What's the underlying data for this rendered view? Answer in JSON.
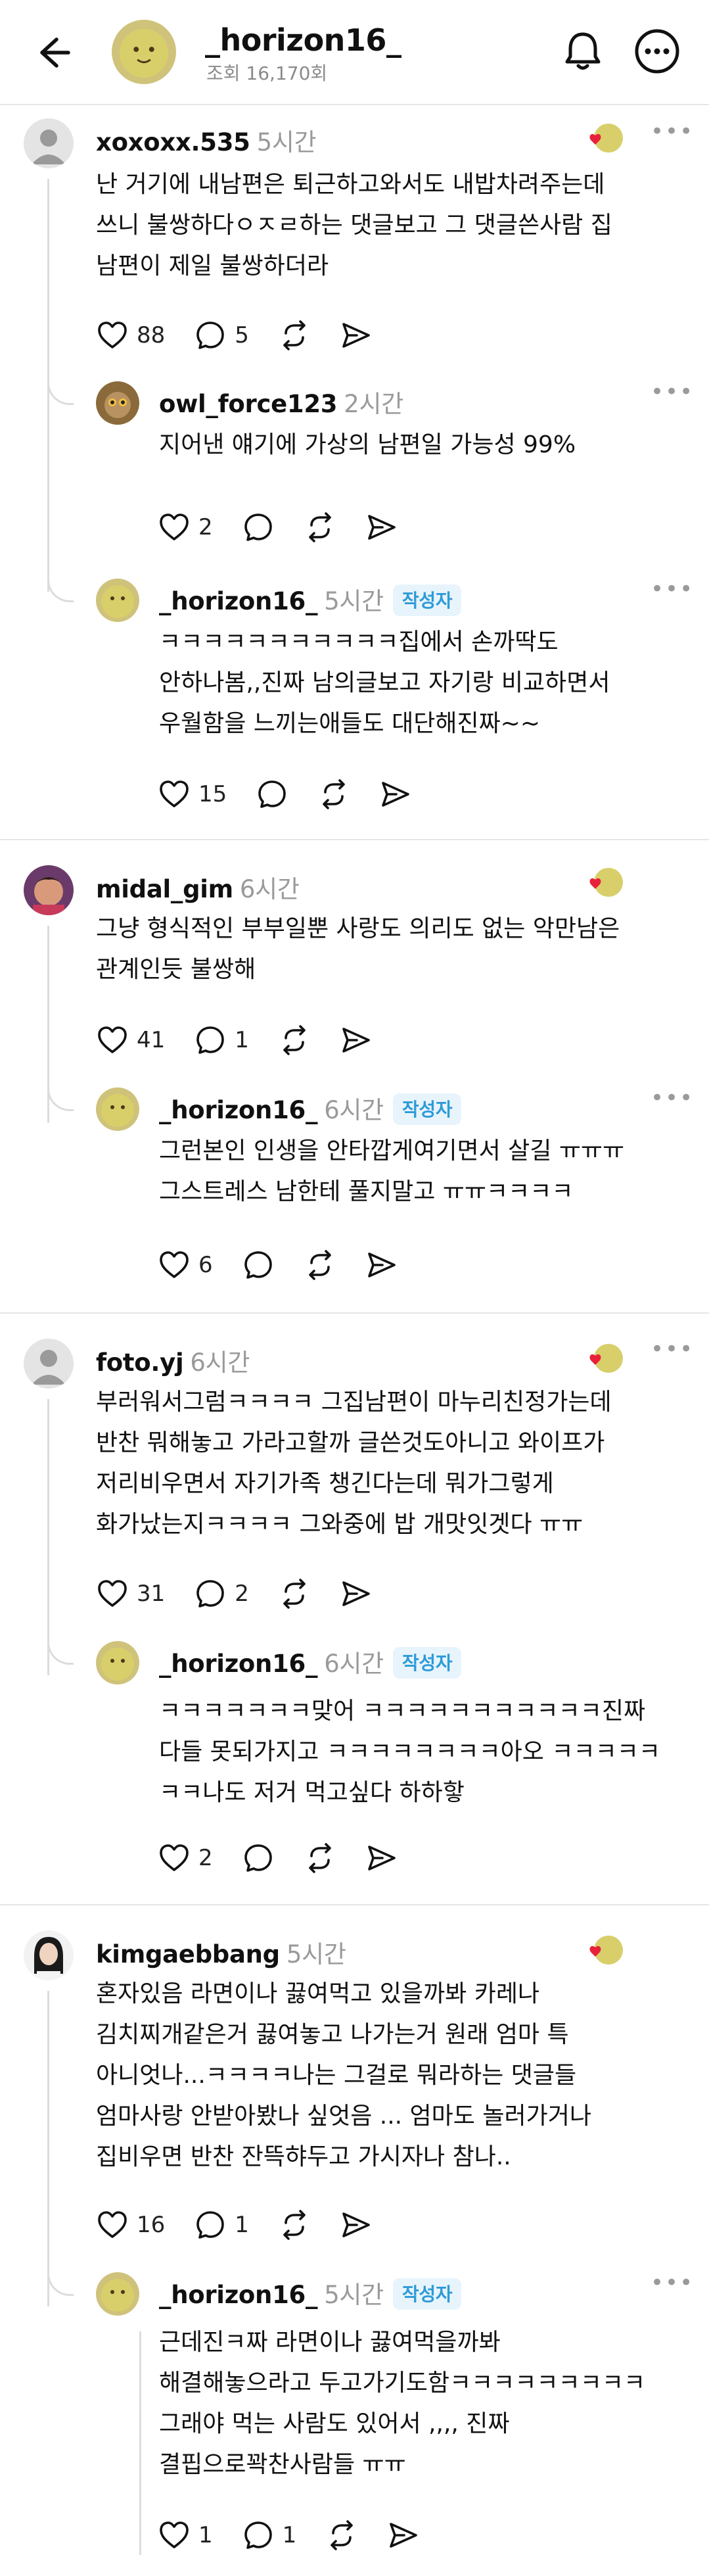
{
  "header": {
    "username": "_horizon16_",
    "views": "조회 16,170회"
  },
  "comments": [
    {
      "user": "xoxoxx.535",
      "time": "5시간",
      "lines": [
        "난 거기에 내남편은 퇴근하고와서도 내밥차려주는데",
        "쓰니 불쌍하다ㅇㅈㄹ하는 댓글보고 그 댓글쓴사람 집",
        "남편이 제일 불쌍하더라"
      ],
      "likes": "88",
      "replies": "5"
    },
    {
      "user": "owl_force123",
      "time": "2시간",
      "lines": [
        "지어낸 얘기에 가상의 남편일 가능성 99%"
      ],
      "likes": "2",
      "replies": ""
    },
    {
      "user": "_horizon16_",
      "time": "5시간",
      "badge": "작성자",
      "lines": [
        "ㅋㅋㅋㅋㅋㅋㅋㅋㅋㅋㅋ집에서 손까딱도",
        "안하나봄,,진짜 남의글보고 자기랑 비교하면서",
        "우월함을 느끼는애들도 대단해진짜~~"
      ],
      "likes": "15",
      "replies": ""
    },
    {
      "user": "midal_gim",
      "time": "6시간",
      "lines": [
        "그냥 형식적인 부부일뿐 사랑도 의리도 없는 악만남은",
        "관계인듯 불쌍해"
      ],
      "likes": "41",
      "replies": "1"
    },
    {
      "user": "_horizon16_",
      "time": "6시간",
      "badge": "작성자",
      "lines": [
        "그런본인 인생을 안타깝게여기면서 살길 ㅠㅠㅠ",
        "그스트레스 남한테 풀지말고 ㅠㅠㅋㅋㅋㅋ"
      ],
      "likes": "6",
      "replies": ""
    },
    {
      "user": "foto.yj",
      "time": "6시간",
      "lines": [
        "부러워서그럼ㅋㅋㅋㅋ 그집남편이 마누리친정가는데",
        "반찬 뭐해놓고 가라고할까 글쓴것도아니고 와이프가",
        "저리비우면서 자기가족 챙긴다는데 뭐가그렇게",
        "화가났는지ㅋㅋㅋㅋ 그와중에 밥 개맛잇겟다 ㅠㅠ"
      ],
      "likes": "31",
      "replies": "2"
    },
    {
      "user": "_horizon16_",
      "time": "6시간",
      "badge": "작성자",
      "lines": [
        "ㅋㅋㅋㅋㅋㅋㅋ맞어 ㅋㅋㅋㅋㅋㅋㅋㅋㅋㅋㅋ진짜",
        "다들 못되가지고 ㅋㅋㅋㅋㅋㅋㅋㅋ아오 ㅋㅋㅋㅋㅋ",
        "ㅋㅋ나도 저거 먹고싶다 하하핳"
      ],
      "likes": "2",
      "replies": ""
    },
    {
      "user": "kimgaebbang",
      "time": "5시간",
      "lines": [
        "혼자있음 라면이나 끓여먹고 있을까봐 카레나",
        "김치찌개같은거 끓여놓고 나가는거 원래 엄마 특",
        "아니엇나...ㅋㅋㅋㅋ나는 그걸로 뭐라하는 댓글들",
        "엄마사랑 안받아봤나 싶엇음 ... 엄마도 놀러가거나",
        "집비우면 반찬 잔뜩햐두고 가시자나 참나.."
      ],
      "likes": "16",
      "replies": "1"
    },
    {
      "user": "_horizon16_",
      "time": "5시간",
      "badge": "작성자",
      "lines": [
        "근데진ㅋ짜 라면이나 끓여먹을까봐",
        "해결해놓으라고 두고가기도함ㅋㅋㅋㅋㅋㅋㅋㅋㅋ",
        "그래야 먹는 사람도 있어서 ,,,, 진짜",
        "결핍으로꽉찬사람들 ㅠㅠ"
      ],
      "likes": "1",
      "replies": "1"
    }
  ],
  "colors": {
    "accent": "#2d9bd8",
    "heart": "#e8213b",
    "muted": "#9a9a9a"
  },
  "icons": [
    "back-arrow-icon",
    "bell-icon",
    "more-icon",
    "heart-icon",
    "comment-icon",
    "repost-icon",
    "share-icon"
  ]
}
